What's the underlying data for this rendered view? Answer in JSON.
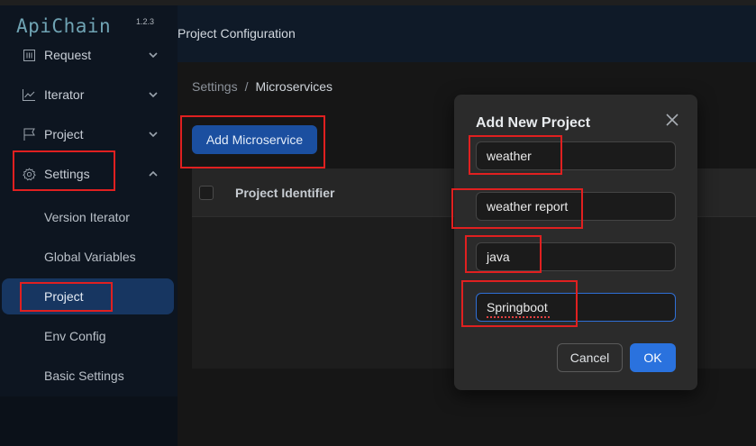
{
  "app": {
    "name": "ApiChain",
    "version": "1.2.3"
  },
  "sidebar": {
    "items": [
      {
        "label": "Request",
        "icon": "request-icon"
      },
      {
        "label": "Iterator",
        "icon": "chart-icon"
      },
      {
        "label": "Project",
        "icon": "flag-icon"
      },
      {
        "label": "Settings",
        "icon": "gear-icon"
      }
    ],
    "sub_items": [
      {
        "label": "Version Iterator"
      },
      {
        "label": "Global Variables"
      },
      {
        "label": "Project"
      },
      {
        "label": "Env Config"
      },
      {
        "label": "Basic Settings"
      }
    ]
  },
  "header": {
    "title": "Project Configuration"
  },
  "breadcrumb": {
    "root": "Settings",
    "separator": "/",
    "current": "Microservices"
  },
  "toolbar": {
    "add_label": "Add Microservice"
  },
  "table": {
    "columns": [
      "Project Identifier"
    ]
  },
  "modal": {
    "title": "Add New Project",
    "fields": [
      {
        "value": "weather"
      },
      {
        "value": "weather report"
      },
      {
        "value": "java"
      },
      {
        "value": "Springboot"
      }
    ],
    "cancel_label": "Cancel",
    "ok_label": "OK"
  },
  "colors": {
    "accent": "#2a72de",
    "highlight": "#e02020",
    "active_bg": "#173661"
  }
}
